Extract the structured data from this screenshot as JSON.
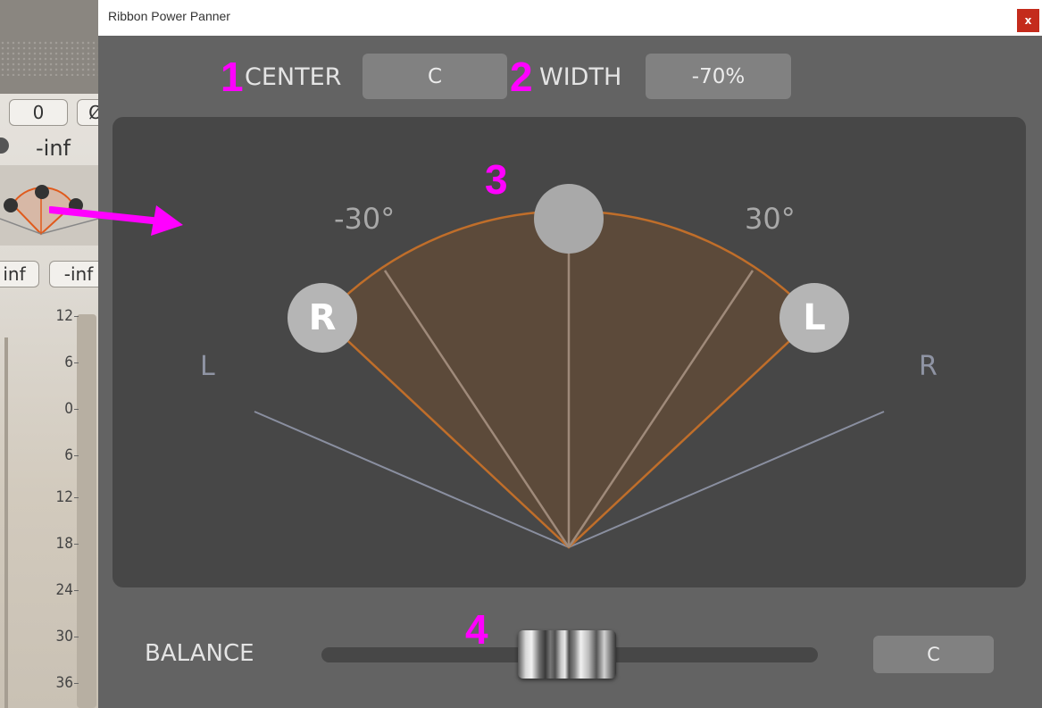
{
  "host": {
    "pan_value": "0",
    "phase_symbol": "Ø",
    "volume_readout": "-inf",
    "peak_left": "inf",
    "peak_right": "-inf",
    "scale_labels": [
      "12",
      "6",
      "0",
      "6",
      "12",
      "18",
      "24",
      "30",
      "36"
    ]
  },
  "window": {
    "title": "Ribbon Power Panner",
    "close_label": "x"
  },
  "controls": {
    "center_label": "CENTER",
    "center_value": "C",
    "width_label": "WIDTH",
    "width_value": "-70%",
    "balance_label": "BALANCE",
    "balance_value": "C",
    "balance_position": 0.5
  },
  "panner": {
    "angle_left_label": "-30°",
    "angle_right_label": "30°",
    "handle_r_label": "R",
    "handle_l_label": "L",
    "speaker_left_label": "L",
    "speaker_right_label": "R"
  },
  "annotations": {
    "marker_1": "1",
    "marker_2": "2",
    "marker_3": "3",
    "marker_4": "4"
  },
  "colors": {
    "accent": "#c06e2a",
    "arc_fill": "#5c4a3a",
    "annotation": "#ff00ff"
  }
}
